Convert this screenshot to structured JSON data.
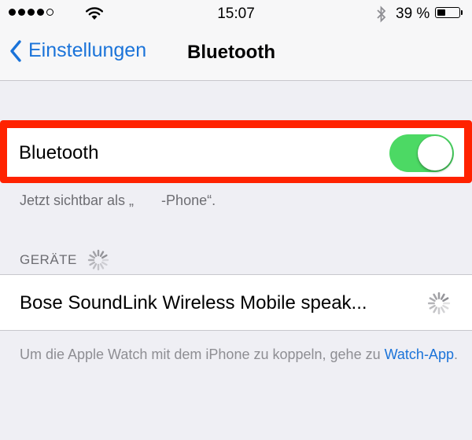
{
  "status_bar": {
    "signal_bars_filled": 4,
    "signal_bars_total": 5,
    "time": "15:07",
    "battery_percent_text": "39 %",
    "battery_level": 0.39,
    "icons": [
      "signal-dots-icon",
      "wifi-icon",
      "bluetooth-icon",
      "battery-icon"
    ]
  },
  "nav": {
    "back_label": "Einstellungen",
    "title": "Bluetooth"
  },
  "bluetooth_toggle": {
    "label": "Bluetooth",
    "on": true,
    "on_color": "#4cd964",
    "highlight_color": "#ff2200"
  },
  "visibility_note": "Jetzt sichtbar als „       -Phone“.",
  "devices_section": {
    "title": "GERÄTE",
    "loading": true,
    "devices": [
      {
        "name": "Bose SoundLink Wireless Mobile speak...",
        "connecting": true
      }
    ]
  },
  "footer": {
    "text_before": "Um die Apple Watch mit dem iPhone zu koppeln, gehe zu ",
    "link": "Watch-App",
    "text_after": ".",
    "link_color": "#1a73d9"
  }
}
